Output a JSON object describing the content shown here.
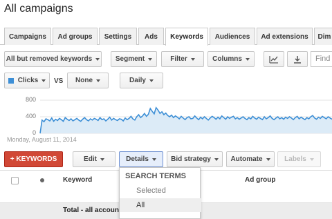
{
  "page_title": "All campaigns",
  "tabs": [
    "Campaigns",
    "Ad groups",
    "Settings",
    "Ads",
    "Keywords",
    "Audiences",
    "Ad extensions",
    "Dim"
  ],
  "active_tab": "Keywords",
  "toolbar": {
    "filter_view": "All but removed keywords",
    "segment": "Segment",
    "filter": "Filter",
    "columns": "Columns",
    "search_placeholder": "Find"
  },
  "chart_controls": {
    "metric1": "Clicks",
    "vs": "VS",
    "metric2": "None",
    "interval": "Daily"
  },
  "chart_data": {
    "type": "area",
    "ylim": [
      0,
      800
    ],
    "yticks": [
      "800",
      "400",
      "0"
    ],
    "start_date": "Monday, August 11, 2014",
    "series": [
      {
        "color": "#3d8fd6",
        "values": [
          0,
          320,
          280,
          350,
          330,
          300,
          370,
          290,
          340,
          310,
          360,
          330,
          290,
          380,
          340,
          310,
          350,
          300,
          330,
          360,
          320,
          290,
          340,
          380,
          330,
          300,
          350,
          320,
          360,
          340,
          310,
          380,
          330,
          350,
          300,
          340,
          390,
          320,
          360,
          330,
          310,
          350,
          340,
          300,
          370,
          330,
          360,
          410,
          350,
          320,
          400,
          450,
          380,
          420,
          480,
          410,
          460,
          600,
          530,
          470,
          620,
          560,
          480,
          520,
          450,
          490,
          430,
          400,
          440,
          380,
          420,
          390,
          350,
          410,
          370,
          330,
          380,
          400,
          350,
          360,
          420,
          370,
          330,
          390,
          350,
          400,
          360,
          320,
          370,
          410,
          380,
          340,
          390,
          350,
          420,
          380,
          340,
          400,
          360,
          390,
          410,
          350,
          380,
          340,
          370,
          400,
          360,
          330,
          380,
          350,
          410,
          370,
          340,
          390,
          360,
          330,
          400,
          350,
          380,
          420,
          360,
          330,
          370,
          400,
          350,
          380,
          340,
          390,
          360,
          400,
          370,
          330,
          380,
          410,
          350,
          390,
          360,
          330,
          380,
          350,
          400,
          430,
          370,
          340,
          390,
          360,
          410,
          380,
          350,
          400,
          370,
          340
        ]
      }
    ]
  },
  "actions": {
    "add_keywords": "+ KEYWORDS",
    "edit": "Edit",
    "details": "Details",
    "bid_strategy": "Bid strategy",
    "automate": "Automate",
    "labels": "Labels"
  },
  "details_menu": {
    "header": "SEARCH TERMS",
    "items": [
      "Selected",
      "All"
    ]
  },
  "table": {
    "columns": [
      "Keyword",
      "Ad group"
    ],
    "total_label": "Total - all accoun"
  }
}
